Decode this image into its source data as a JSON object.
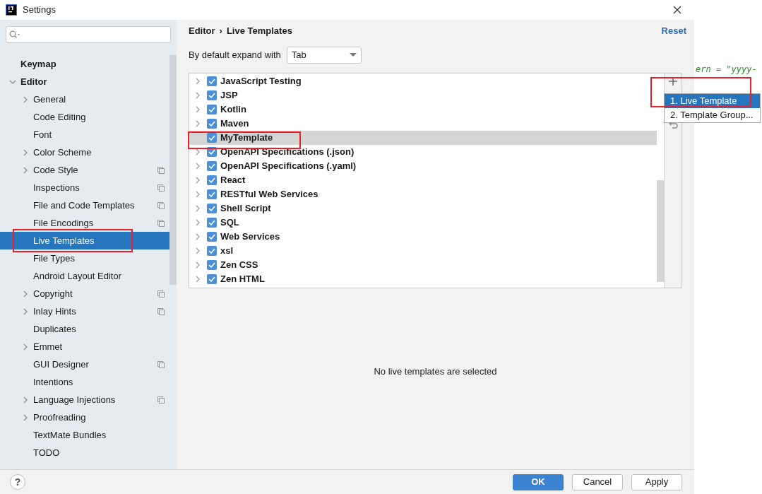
{
  "window": {
    "title": "Settings"
  },
  "sidebar": {
    "items": [
      {
        "label": "Keymap",
        "selected": false
      },
      {
        "label": "Editor",
        "selected": false,
        "expanded": true,
        "children": [
          {
            "label": "General",
            "selected": false,
            "expanded": false
          },
          {
            "label": "Code Editing",
            "selected": false
          },
          {
            "label": "Font",
            "selected": false
          },
          {
            "label": "Color Scheme",
            "selected": false,
            "expanded": false
          },
          {
            "label": "Code Style",
            "selected": false,
            "expanded": false,
            "project_level": true
          },
          {
            "label": "Inspections",
            "selected": false,
            "project_level": true
          },
          {
            "label": "File and Code Templates",
            "selected": false,
            "project_level": true
          },
          {
            "label": "File Encodings",
            "selected": false,
            "project_level": true
          },
          {
            "label": "Live Templates",
            "selected": true
          },
          {
            "label": "File Types",
            "selected": false
          },
          {
            "label": "Android Layout Editor",
            "selected": false
          },
          {
            "label": "Copyright",
            "selected": false,
            "expanded": false,
            "project_level": true
          },
          {
            "label": "Inlay Hints",
            "selected": false,
            "expanded": false,
            "project_level": true
          },
          {
            "label": "Duplicates",
            "selected": false
          },
          {
            "label": "Emmet",
            "selected": false,
            "expanded": false
          },
          {
            "label": "GUI Designer",
            "selected": false,
            "project_level": true
          },
          {
            "label": "Intentions",
            "selected": false
          },
          {
            "label": "Language Injections",
            "selected": false,
            "expanded": false,
            "project_level": true
          },
          {
            "label": "Proofreading",
            "selected": false,
            "expanded": false
          },
          {
            "label": "TextMate Bundles",
            "selected": false
          },
          {
            "label": "TODO",
            "selected": false
          }
        ]
      }
    ]
  },
  "breadcrumb": [
    "Editor",
    "›",
    "Live Templates"
  ],
  "reset_link": "Reset",
  "expand_with": {
    "label": "By default expand with",
    "value": "Tab"
  },
  "templates": [
    {
      "label": "JavaScript Testing",
      "checked": true,
      "selected": false,
      "expanded": false
    },
    {
      "label": "JSP",
      "checked": true,
      "selected": false,
      "expanded": false
    },
    {
      "label": "Kotlin",
      "checked": true,
      "selected": false,
      "expanded": false
    },
    {
      "label": "Maven",
      "checked": true,
      "selected": false,
      "expanded": false
    },
    {
      "label": "MyTemplate",
      "checked": true,
      "selected": true
    },
    {
      "label": "OpenAPI Specifications (.json)",
      "checked": true,
      "selected": false,
      "expanded": false
    },
    {
      "label": "OpenAPI Specifications (.yaml)",
      "checked": true,
      "selected": false,
      "expanded": false
    },
    {
      "label": "React",
      "checked": true,
      "selected": false,
      "expanded": false
    },
    {
      "label": "RESTful Web Services",
      "checked": true,
      "selected": false,
      "expanded": false
    },
    {
      "label": "Shell Script",
      "checked": true,
      "selected": false,
      "expanded": false
    },
    {
      "label": "SQL",
      "checked": true,
      "selected": false,
      "expanded": false
    },
    {
      "label": "Web Services",
      "checked": true,
      "selected": false,
      "expanded": false
    },
    {
      "label": "xsl",
      "checked": true,
      "selected": false,
      "expanded": false
    },
    {
      "label": "Zen CSS",
      "checked": true,
      "selected": false,
      "expanded": false
    },
    {
      "label": "Zen HTML",
      "checked": true,
      "selected": false,
      "expanded": false
    }
  ],
  "add_menu": [
    {
      "label": "1. Live Template",
      "selected": true
    },
    {
      "label": "2. Template Group...",
      "selected": false
    }
  ],
  "empty_message": "No live templates are selected",
  "buttons": [
    {
      "label": "OK",
      "kind": "primary"
    },
    {
      "label": "Cancel",
      "kind": "secondary"
    },
    {
      "label": "Apply",
      "kind": "secondary"
    }
  ],
  "help_button": "?",
  "editor_background": {
    "code": "ern = \"yyyy-"
  }
}
